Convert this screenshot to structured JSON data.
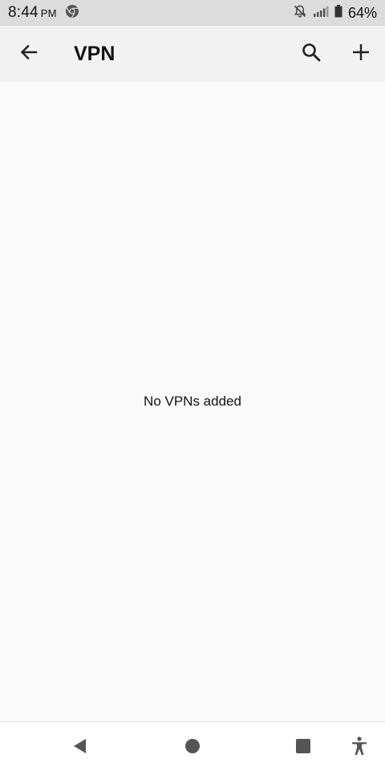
{
  "status_bar": {
    "time": "8:44",
    "ampm": "PM",
    "battery_percent": "64%",
    "icons": [
      "chrome-icon",
      "notifications-off-icon",
      "signal-icon",
      "battery-icon"
    ]
  },
  "app_bar": {
    "title": "VPN",
    "icons": [
      "back-arrow-icon",
      "search-icon",
      "add-icon"
    ]
  },
  "main": {
    "empty_message": "No VPNs added"
  },
  "nav_bar": {
    "icons": [
      "back-triangle-icon",
      "home-circle-icon",
      "recents-square-icon",
      "accessibility-icon"
    ]
  },
  "colors": {
    "status_bar_bg": "#dcdcdc",
    "app_bar_bg": "#f2f2f2",
    "content_bg": "#fafafa",
    "nav_bar_bg": "#ffffff",
    "icon": "#222222",
    "nav_icon": "#555555"
  }
}
